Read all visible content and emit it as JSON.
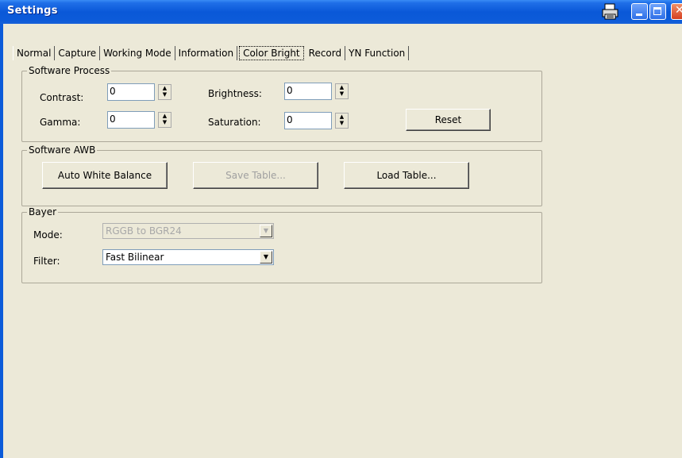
{
  "window": {
    "title": "Settings",
    "controls": {
      "print": "printer-icon",
      "minimize": "minimize-icon",
      "maximize": "maximize-icon",
      "close": "close-icon"
    },
    "colors": {
      "titlebar": "#0a58d8",
      "body": "#ece9d8"
    }
  },
  "tabs": [
    {
      "label": "Normal"
    },
    {
      "label": "Capture"
    },
    {
      "label": "Working Mode"
    },
    {
      "label": "Information"
    },
    {
      "label": "Color Bright",
      "active": true
    },
    {
      "label": "Record"
    },
    {
      "label": "YN Function"
    }
  ],
  "software_process": {
    "title": "Software Process",
    "contrast": {
      "label": "Contrast:",
      "value": "0"
    },
    "brightness": {
      "label": "Brightness:",
      "value": "0"
    },
    "gamma": {
      "label": "Gamma:",
      "value": "0"
    },
    "saturation": {
      "label": "Saturation:",
      "value": "0"
    },
    "reset_label": "Reset"
  },
  "software_awb": {
    "title": "Software AWB",
    "auto_white_balance_label": "Auto White Balance",
    "save_table_label": "Save Table...",
    "load_table_label": "Load Table..."
  },
  "bayer": {
    "title": "Bayer",
    "mode_label": "Mode:",
    "mode_value": "RGGB to BGR24",
    "filter_label": "Filter:",
    "filter_value": "Fast Bilinear"
  }
}
